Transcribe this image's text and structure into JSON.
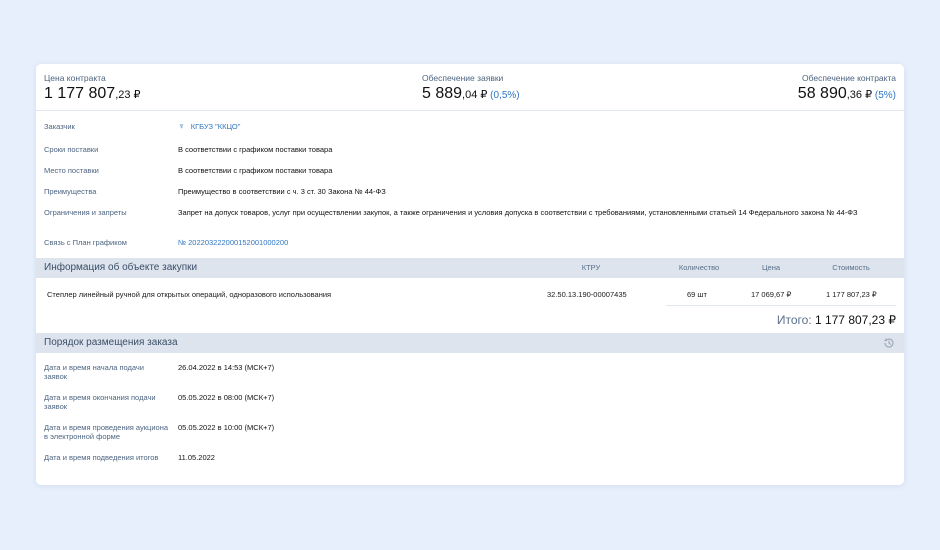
{
  "prices": {
    "contract": {
      "label": "Цена контракта",
      "main": "1 177 807",
      "kop": ",23",
      "cur": " ₽",
      "pct": ""
    },
    "bid_security": {
      "label": "Обеспечение заявки",
      "main": "5 889",
      "kop": ",04",
      "cur": " ₽",
      "pct": " (0,5%)"
    },
    "contract_security": {
      "label": "Обеспечение контракта",
      "main": "58 890",
      "kop": ",36",
      "cur": " ₽",
      "pct": " (5%)"
    }
  },
  "details": [
    {
      "key": "Заказчик",
      "value": "КГБУЗ \"ККЦО\""
    },
    {
      "key": "Сроки поставки",
      "value": "В соответствии с графиком поставки товара"
    },
    {
      "key": "Место поставки",
      "value": "В соответствии с графиком поставки товара"
    },
    {
      "key": "Преимущества",
      "value": "Преимущество в соответствии с ч. 3 ст. 30 Закона № 44-ФЗ"
    },
    {
      "key": "Ограничения и запреты",
      "value": "Запрет на допуск товаров, услуг при осуществлении закупок, а также ограничения и условия допуска в соответствии с требованиями, установленными статьей 14 Федерального закона № 44-ФЗ"
    },
    {
      "key": "Связь с План графиком",
      "value": "№ 202203222000152001000200"
    }
  ],
  "purchase": {
    "title": "Информация об объекте закупки",
    "columns": {
      "ktru": "КТРУ",
      "qty": "Количество",
      "price": "Цена",
      "cost": "Стоимость"
    },
    "item": {
      "name": "Степлер линейный ручной для открытых операций, одноразового использования",
      "ktru": "32.50.13.190-00007435",
      "qty": "69 шт",
      "price": "17 069,67 ₽",
      "cost": "1 177 807,23 ₽"
    },
    "total_label": "Итого: ",
    "total_value": "1 177 807,23 ₽"
  },
  "order": {
    "title": "Порядок размещения заказа",
    "rows": [
      {
        "key": "Дата и время начала подачи заявок",
        "value": "26.04.2022 в 14:53 (МСК+7)"
      },
      {
        "key": "Дата и время окончания подачи заявок",
        "value": "05.05.2022 в 08:00 (МСК+7)"
      },
      {
        "key": "Дата и время проведения аукциона в электронной форме",
        "value": "05.05.2022 в 10:00 (МСК+7)"
      },
      {
        "key": "Дата и время подведения итогов",
        "value": "11.05.2022"
      }
    ]
  }
}
